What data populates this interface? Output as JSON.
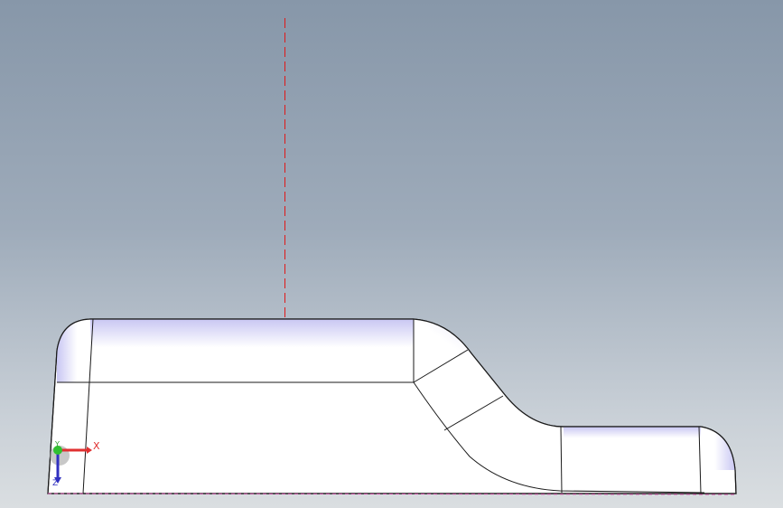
{
  "viewport": {
    "background_top": "#8797a9",
    "background_bottom": "#dadee1"
  },
  "part": {
    "fill_color": "#ffffff",
    "edge_color": "#1a1a1a",
    "shade_color": "#c7c5f1"
  },
  "sketch_line": {
    "color": "#e01818",
    "style": "dashed"
  },
  "triad": {
    "x_label": "X",
    "y_label": "Y",
    "z_label": "Z",
    "x_color": "#e03030",
    "y_color": "#30c030",
    "z_color": "#3030c0"
  }
}
